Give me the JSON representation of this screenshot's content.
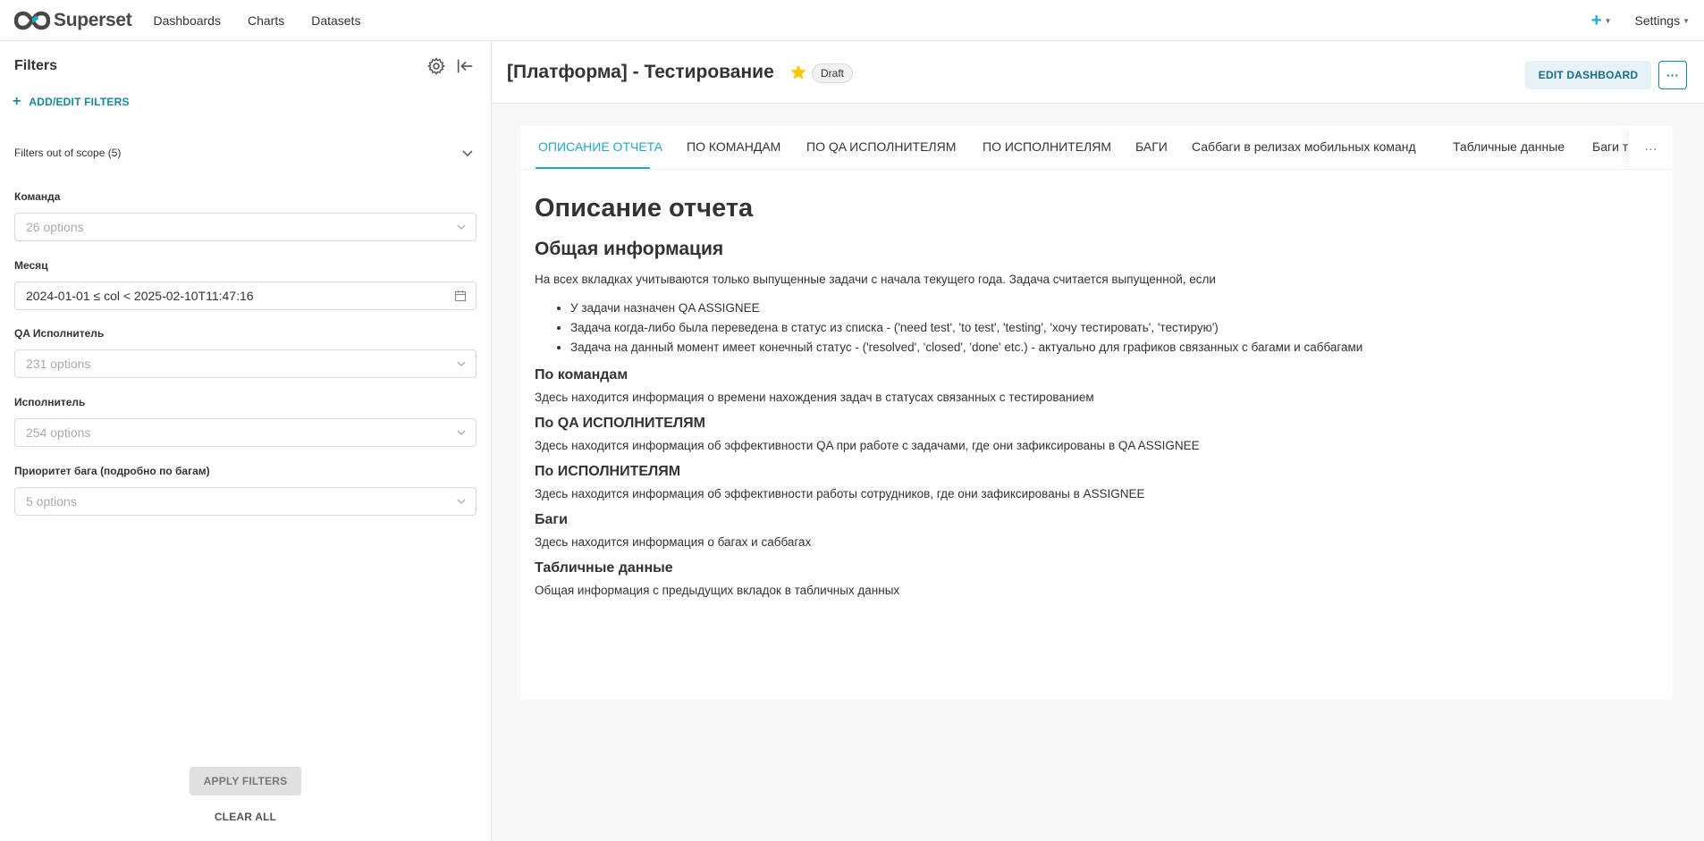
{
  "nav": {
    "brand": "Superset",
    "links": [
      "Dashboards",
      "Charts",
      "Datasets"
    ],
    "plus": "+",
    "settings": "Settings"
  },
  "sidebar": {
    "title": "Filters",
    "add_filters": "ADD/EDIT FILTERS",
    "scope": "Filters out of scope (5)",
    "filters": [
      {
        "label": "Команда",
        "placeholder": "26 options",
        "value": ""
      },
      {
        "label": "Месяц",
        "placeholder": "",
        "value": "2024-01-01 ≤ col < 2025-02-10T11:47:16"
      },
      {
        "label": "QA Исполнитель",
        "placeholder": "231 options",
        "value": ""
      },
      {
        "label": "Исполнитель",
        "placeholder": "254 options",
        "value": ""
      },
      {
        "label": "Приоритет бага (подробно по багам)",
        "placeholder": "5 options",
        "value": ""
      }
    ],
    "apply": "APPLY FILTERS",
    "clear": "CLEAR ALL"
  },
  "header": {
    "title": "[Платформа] - Тестирование",
    "badge": "Draft",
    "edit": "EDIT DASHBOARD",
    "more": "···"
  },
  "tabs": [
    "ОПИСАНИЕ ОТЧЕТА",
    "ПО КОМАНДАМ",
    "ПО QA ИСПОЛНИТЕЛЯМ",
    "ПО ИСПОЛНИТЕЛЯМ",
    "БАГИ",
    "Саббаги в релизах мобильных команд",
    "Табличные данные",
    "Баги т"
  ],
  "tabs_more": "···",
  "content": {
    "h1": "Описание отчета",
    "h2": "Общая информация",
    "intro": "На всех вкладках учитываются только выпущенные задачи с начала текущего года. Задача считается выпущенной, если",
    "bullets": [
      "У задачи назначен QA ASSIGNEE",
      "Задача когда-либо была переведена в статус из списка - ('need test', 'to test', 'testing', 'хочу тестировать', 'тестирую')",
      "Задача на данный момент имеет конечный статус - ('resolved', 'closed', 'done' etc.) - актуально для графиков связанных с багами и саббагами"
    ],
    "sections": [
      {
        "title": "По командам",
        "text": "Здесь находится информация о времени нахождения задач в статусах связанных с тестированием"
      },
      {
        "title": "По QA ИСПОЛНИТЕЛЯМ",
        "text": "Здесь находится информация об эффективности QA при работе с задачами, где они зафиксированы в QA ASSIGNEE"
      },
      {
        "title": "По ИСПОЛНИТЕЛЯМ",
        "text": "Здесь находится информация об эффективности работы сотрудников, где они зафиксированы в ASSIGNEE"
      },
      {
        "title": "Баги",
        "text": "Здесь находится информация о багах и саббагах"
      },
      {
        "title": "Табличные данные",
        "text": "Общая информация с предыдущих вкладок в табличных данных"
      }
    ]
  }
}
